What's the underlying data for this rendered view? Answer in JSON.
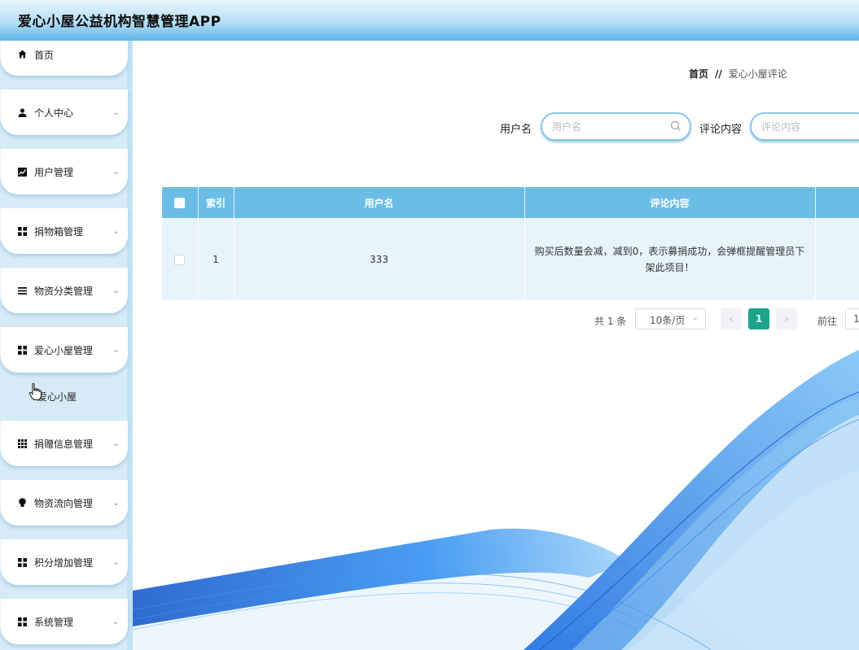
{
  "app": {
    "title": "爱心小屋公益机构智慧管理APP"
  },
  "sidebar": {
    "items": [
      {
        "label": "首页",
        "icon": "home-icon",
        "has_chevron": false
      },
      {
        "label": "个人中心",
        "icon": "user-icon",
        "has_chevron": true
      },
      {
        "label": "用户管理",
        "icon": "chart-icon",
        "has_chevron": true
      },
      {
        "label": "捐物箱管理",
        "icon": "grid-icon",
        "has_chevron": true
      },
      {
        "label": "物资分类管理",
        "icon": "list-icon",
        "has_chevron": true
      },
      {
        "label": "爱心小屋管理",
        "icon": "grid-icon",
        "has_chevron": true
      },
      {
        "label": "捐赠信息管理",
        "icon": "apps-icon",
        "has_chevron": true
      },
      {
        "label": "物资流向管理",
        "icon": "bulb-icon",
        "has_chevron": true
      },
      {
        "label": "积分增加管理",
        "icon": "grid-icon",
        "has_chevron": true
      },
      {
        "label": "系统管理",
        "icon": "grid-icon",
        "has_chevron": true
      }
    ],
    "submenu": {
      "label": "爱心小屋"
    }
  },
  "breadcrumb": {
    "home": "首页",
    "separator": "//",
    "current": "爱心小屋评论"
  },
  "search": {
    "username_label": "用户名",
    "username_placeholder": "用户名",
    "comment_label": "评论内容",
    "comment_placeholder": "评论内容"
  },
  "table": {
    "headers": [
      "索引",
      "用户名",
      "评论内容"
    ],
    "rows": [
      {
        "index": "1",
        "username": "333",
        "comment": "购买后数量会减，减到0，表示募捐成功，会弹框提醒管理员下架此项目！"
      }
    ]
  },
  "pagination": {
    "total": "共 1 条",
    "page_size": "10条/页",
    "current_page": "1",
    "goto_label": "前往",
    "goto_value": "1"
  },
  "colors": {
    "header_blue": "#5fb4e6",
    "table_header": "#6cbde6",
    "active_page": "#1ca58a",
    "sidebar_bg": "#d7ebf6"
  }
}
